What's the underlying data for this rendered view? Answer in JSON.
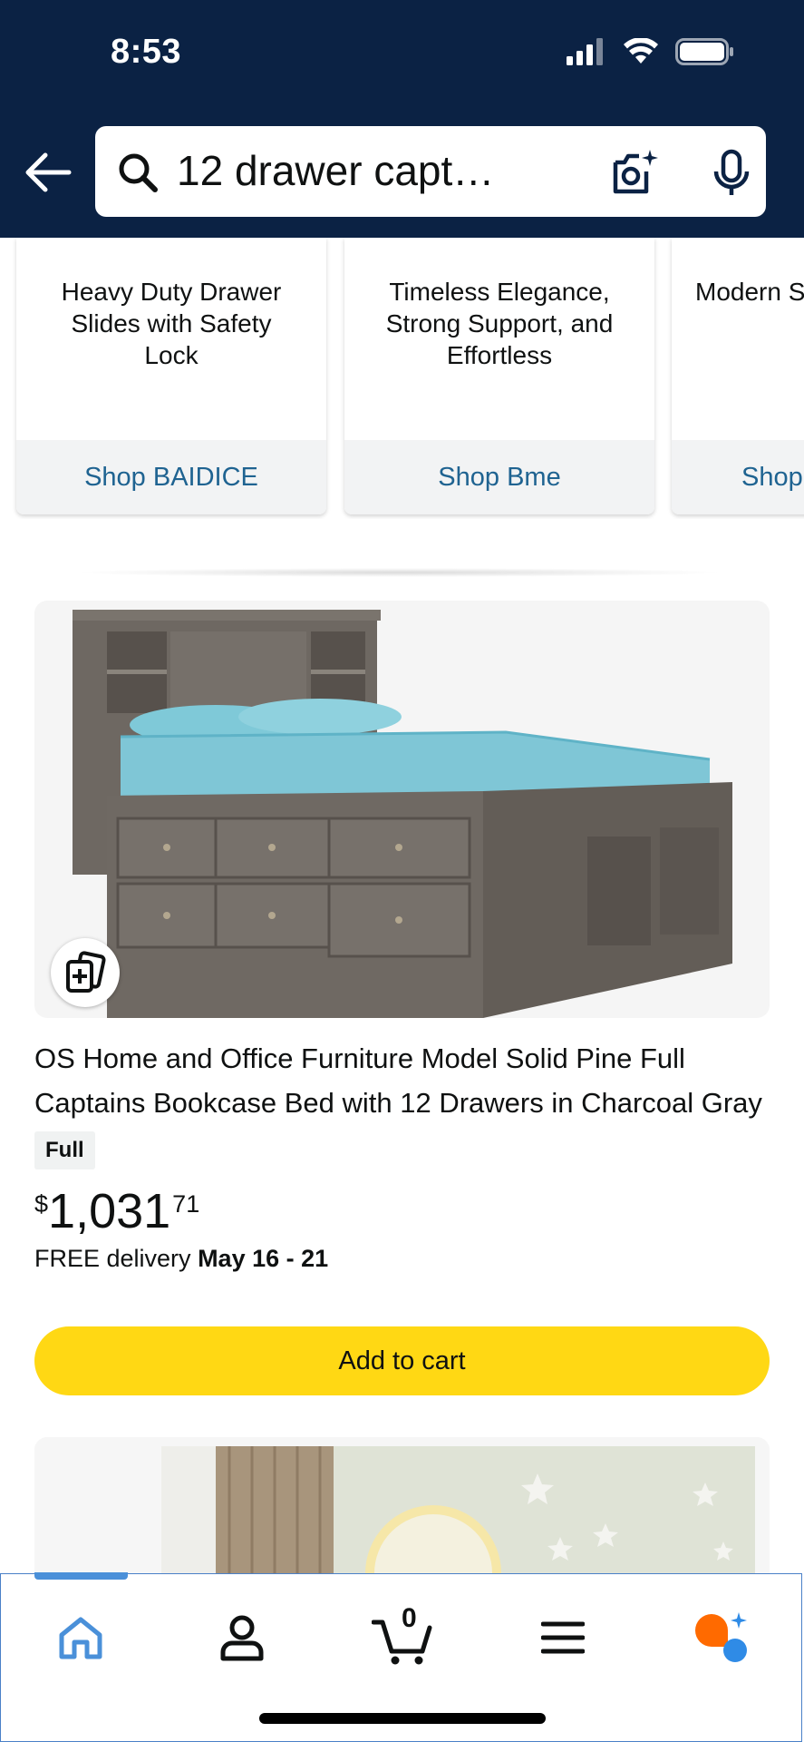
{
  "status_bar": {
    "time": "8:53"
  },
  "header": {
    "search_query": "12 drawer capt…",
    "icons": [
      "back-arrow-icon",
      "search-icon",
      "camera-lens-icon",
      "microphone-icon"
    ]
  },
  "brand_cards": [
    {
      "tagline": "Heavy Duty Drawer Slides with Safety Lock",
      "shop_label": "Shop BAIDICE"
    },
    {
      "tagline": "Timeless Elegance, Strong Support, and Effortless",
      "shop_label": "Shop Bme"
    },
    {
      "tagline": "Modern S USB Po L",
      "shop_label": "Shop"
    }
  ],
  "product": {
    "title": "OS Home and Office Furniture Model Solid Pine Full Captains Bookcase Bed with 12 Drawers in Charcoal Gray",
    "variant": "Full",
    "price_symbol": "$",
    "price_whole": "1,031",
    "price_fraction": "71",
    "delivery_prefix": "FREE delivery ",
    "delivery_dates": "May 16 - 21",
    "add_to_cart_label": "Add to cart"
  },
  "bottom_nav": {
    "items": [
      "home-icon",
      "account-icon",
      "cart-icon",
      "menu-icon",
      "rufus-ai-icon"
    ],
    "cart_count": "0",
    "active": "home"
  },
  "colors": {
    "header_bg": "#0b2244",
    "link": "#1f6391",
    "add_to_cart": "#ffd814",
    "nav_active": "#4a90d9"
  }
}
